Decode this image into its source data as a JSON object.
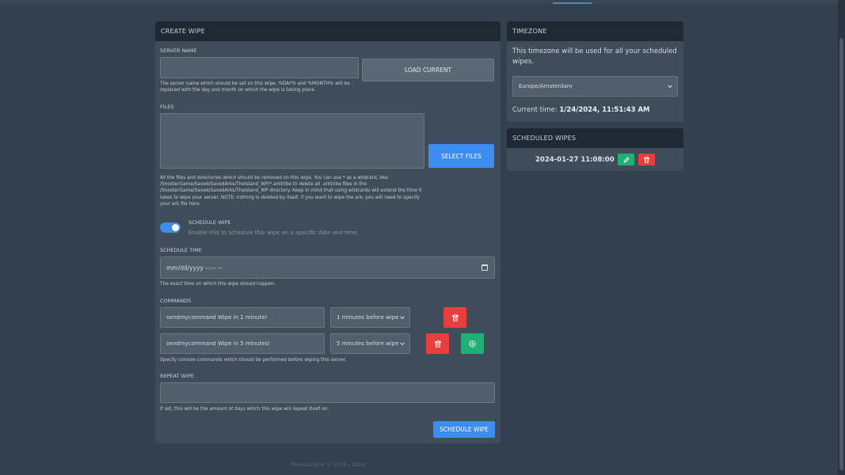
{
  "create_wipe": {
    "title": "CREATE WIPE",
    "server_name": {
      "label": "SERVER NAME",
      "value": "",
      "load_current_label": "LOAD CURRENT",
      "help": "The server name which should be set on this wipe, %DAY% and %MONTH% will be replaced with the day and month on which the wipe is taking place."
    },
    "files": {
      "label": "FILES",
      "value": "",
      "select_files_label": "SELECT FILES",
      "help": "All the files and directories which should be removed on this wipe. You can use * as a wildcard, like: /ShooterGame/Saved/SavedArks/TheIsland_WP/*.arktribe to delete all .arktribe files in the /ShooterGame/Saved/SavedArks/TheIsland_WP directory. Keep in mind that using wildcards will extend the time it takes to wipe your server. NOTE: nothing is deleted by itself, if you want to wipe the ark, you will need to specify your ark file here."
    },
    "schedule_wipe": {
      "label": "SCHEDULE WIPE",
      "help": "Enable this to schedule this wipe on a specific date and time.",
      "enabled": true
    },
    "schedule_time": {
      "label": "SCHEDULE TIME",
      "placeholder": "mm/dd/yyyy --:-- --",
      "help": "The exact time on which this wipe should happen."
    },
    "commands": {
      "label": "COMMANDS",
      "items": [
        {
          "command": "sendmycommand Wipe in 1 minute!",
          "timing": "1 minutes before wipe"
        },
        {
          "command": "sendmycommand Wipe in 5 minutes!",
          "timing": "5 minutes before wipe"
        }
      ],
      "help": "Specify console commands which should be performed before wiping this server."
    },
    "repeat_wipe": {
      "label": "REPEAT WIPE",
      "value": "",
      "help": "If set, this will be the amount of days which this wipe will repeat itself on."
    },
    "submit_label": "SCHEDULE WIPE"
  },
  "timezone": {
    "title": "TIMEZONE",
    "description": "This timezone will be used for all your scheduled wipes.",
    "selected": "Europe/Amsterdam",
    "current_time_label": "Current time:",
    "current_time_value": "1/24/2024, 11:51:43 AM"
  },
  "scheduled_wipes": {
    "title": "SCHEDULED WIPES",
    "items": [
      {
        "datetime": "2024-01-27 11:08:00"
      }
    ]
  },
  "footer": "Pterodactyl® © 2015 - 2024",
  "colors": {
    "background": "#33404d",
    "panel": "#3f4d5a",
    "panel_header": "#1f2933",
    "primary": "#3d8cf0",
    "danger": "#e83e3e",
    "success": "#20b076"
  },
  "icons": {
    "delete": "trash-icon",
    "edit": "pencil-icon",
    "add": "plus-circle-icon",
    "calendar": "calendar-icon",
    "dropdown": "chevron-down-icon"
  }
}
